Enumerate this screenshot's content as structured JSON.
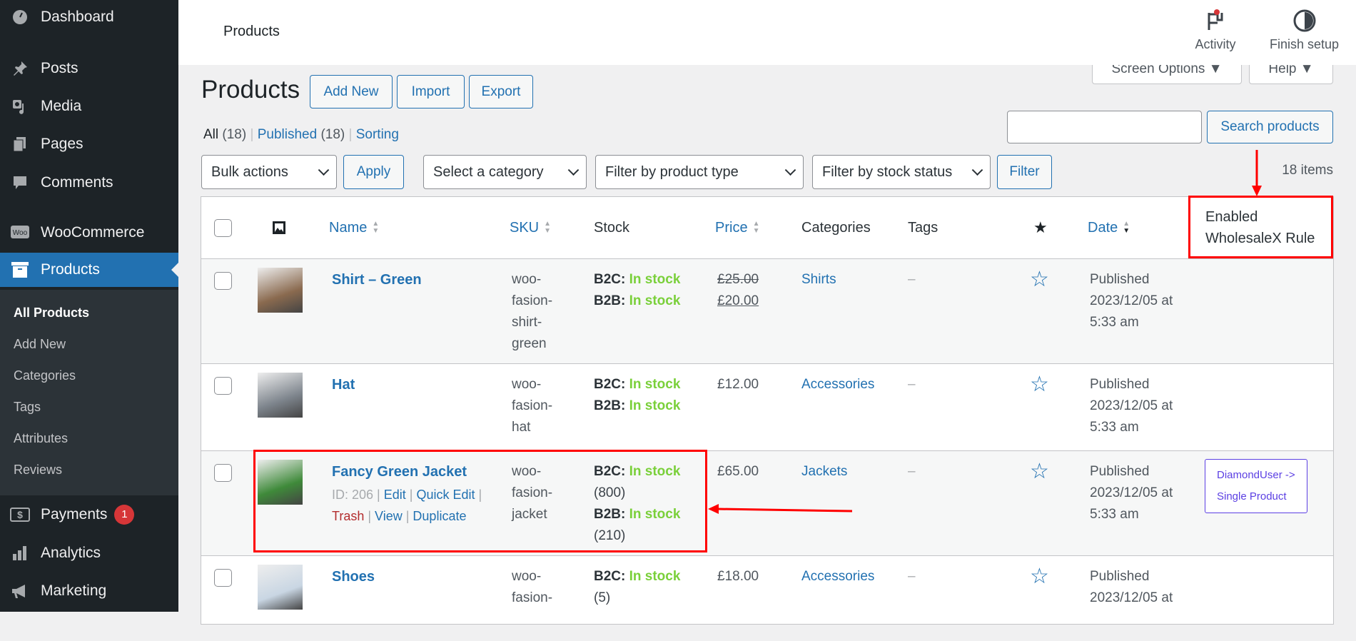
{
  "sidebar": {
    "items": [
      {
        "label": "Dashboard",
        "icon": "dashboard-icon"
      },
      {
        "label": "Posts",
        "icon": "pin-icon"
      },
      {
        "label": "Media",
        "icon": "media-icon"
      },
      {
        "label": "Pages",
        "icon": "pages-icon"
      },
      {
        "label": "Comments",
        "icon": "comment-icon"
      },
      {
        "label": "WooCommerce",
        "icon": "woo-icon"
      },
      {
        "label": "Products",
        "icon": "archive-icon"
      },
      {
        "label": "Payments",
        "icon": "dollar-icon",
        "badge": "1"
      },
      {
        "label": "Analytics",
        "icon": "bar-chart-icon"
      },
      {
        "label": "Marketing",
        "icon": "megaphone-icon"
      }
    ],
    "submenu": [
      "All Products",
      "Add New",
      "Categories",
      "Tags",
      "Attributes",
      "Reviews"
    ]
  },
  "header": {
    "title": "Products",
    "activity": "Activity",
    "finish_setup": "Finish setup"
  },
  "screen_options": "Screen Options ▼",
  "help": "Help ▼",
  "page": {
    "title": "Products",
    "add_new": "Add New",
    "import": "Import",
    "export": "Export",
    "views": {
      "all": "All",
      "all_count": "(18)",
      "published": "Published",
      "published_count": "(18)",
      "sorting": "Sorting"
    },
    "search_value": "",
    "search_button": "Search products",
    "bulk_actions": "Bulk actions",
    "apply": "Apply",
    "category_filter": "Select a category",
    "type_filter": "Filter by product type",
    "stock_filter": "Filter by stock status",
    "filter": "Filter",
    "items_count": "18 items"
  },
  "columns": {
    "name": "Name",
    "sku": "SKU",
    "stock": "Stock",
    "price": "Price",
    "categories": "Categories",
    "tags": "Tags",
    "date": "Date",
    "wholesalex_line1": "Enabled",
    "wholesalex_line2": "WholesaleX Rule"
  },
  "colors": {
    "accent": "#2271b1",
    "in_stock": "#7ad03a",
    "annotation": "#ff0000",
    "rule_badge": "#5b3fe3"
  },
  "products": [
    {
      "name": "Shirt – Green",
      "sku": [
        "woo-",
        "fasion-",
        "shirt-",
        "green"
      ],
      "b2c_label": "B2C:",
      "b2c": "In stock",
      "b2b_label": "B2B:",
      "b2b": "In stock",
      "price_old": "£25.00",
      "price": "£20.00",
      "category": "Shirts",
      "tags": "–",
      "date": [
        "Published",
        "2023/12/05 at",
        "5:33 am"
      ],
      "thumb": "#8a6a4f"
    },
    {
      "name": "Hat",
      "sku": [
        "woo-",
        "fasion-",
        "hat"
      ],
      "b2c_label": "B2C:",
      "b2c": "In stock",
      "b2b_label": "B2B:",
      "b2b": "In stock",
      "price": "£12.00",
      "category": "Accessories",
      "tags": "–",
      "date": [
        "Published",
        "2023/12/05 at",
        "5:33 am"
      ],
      "thumb": "#7d848c"
    },
    {
      "name": "Fancy Green Jacket",
      "id": "ID: 206",
      "actions": [
        "Edit",
        "Quick Edit",
        "Trash",
        "View",
        "Duplicate"
      ],
      "sku": [
        "woo-",
        "fasion-",
        "jacket"
      ],
      "b2c_label": "B2C:",
      "b2c": "In stock",
      "b2c_qty": "(800)",
      "b2b_label": "B2B:",
      "b2b": "In stock",
      "b2b_qty": "(210)",
      "price": "£65.00",
      "category": "Jackets",
      "tags": "–",
      "date": [
        "Published",
        "2023/12/05 at",
        "5:33 am"
      ],
      "rule": [
        "DiamondUser ->",
        "Single Product"
      ],
      "thumb": "#3f8a3a"
    },
    {
      "name": "Shoes",
      "sku": [
        "woo-",
        "fasion-"
      ],
      "b2c_label": "B2C:",
      "b2c": "In stock",
      "b2c_qty": "(5)",
      "price": "£18.00",
      "category": "Accessories",
      "tags": "–",
      "date": [
        "Published",
        "2023/12/05 at"
      ],
      "thumb": "#c9d6e3"
    }
  ]
}
